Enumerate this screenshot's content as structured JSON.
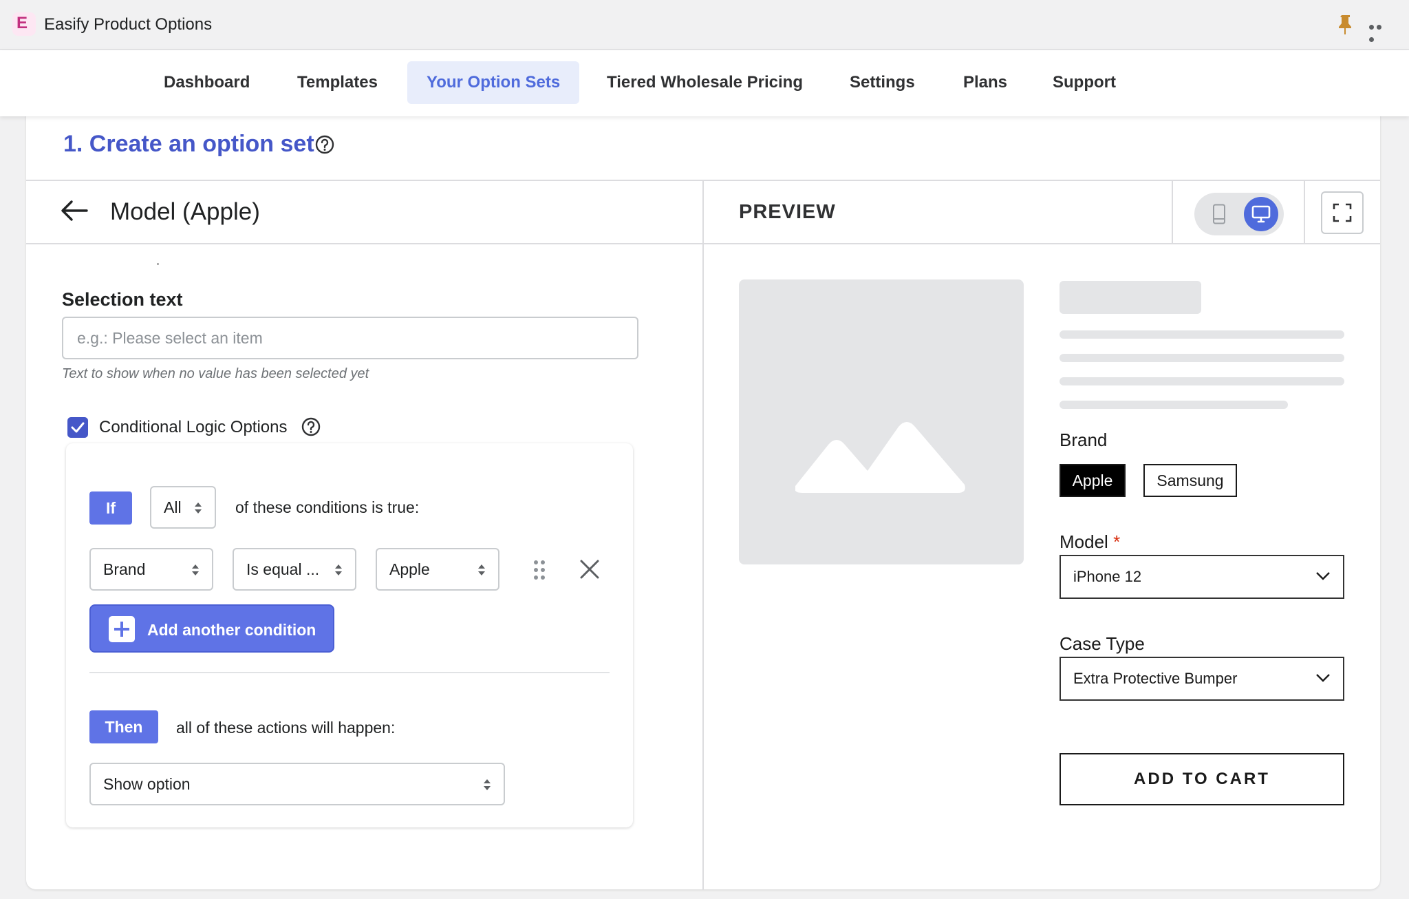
{
  "app": {
    "title": "Easify Product Options",
    "logo_icon": "easify-logo"
  },
  "nav": {
    "items": [
      {
        "label": "Dashboard",
        "active": false
      },
      {
        "label": "Templates",
        "active": false
      },
      {
        "label": "Your Option Sets",
        "active": true
      },
      {
        "label": "Tiered Wholesale Pricing",
        "active": false
      },
      {
        "label": "Settings",
        "active": false
      },
      {
        "label": "Plans",
        "active": false
      },
      {
        "label": "Support",
        "active": false
      }
    ]
  },
  "section": {
    "title": "1. Create an option set"
  },
  "editor": {
    "title": "Model (Apple)",
    "selection_text": {
      "label": "Selection text",
      "value": "",
      "placeholder": "e.g.: Please select an item",
      "helper": "Text to show when no value has been selected yet"
    },
    "conditional_logic": {
      "checked": true,
      "label": "Conditional Logic Options",
      "if_label": "If",
      "match_mode": "All",
      "condition_text": "of these conditions is true:",
      "conditions": [
        {
          "field": "Brand",
          "operator": "Is equal ...",
          "value": "Apple"
        }
      ],
      "add_button": "Add another condition",
      "then_label": "Then",
      "then_text": "all of these actions will happen:",
      "action": "Show option"
    }
  },
  "preview": {
    "label": "PREVIEW",
    "view_mode": "desktop",
    "brand": {
      "label": "Brand",
      "options": [
        "Apple",
        "Samsung"
      ],
      "selected": "Apple"
    },
    "model": {
      "label": "Model",
      "required_mark": "*",
      "value": "iPhone 12"
    },
    "case_type": {
      "label": "Case Type",
      "value": "Extra Protective Bumper"
    },
    "add_to_cart": "ADD TO CART"
  },
  "colors": {
    "accent": "#4f6bdc",
    "button": "#5f73e6",
    "title": "#4557c8",
    "required": "#d72c0d"
  }
}
